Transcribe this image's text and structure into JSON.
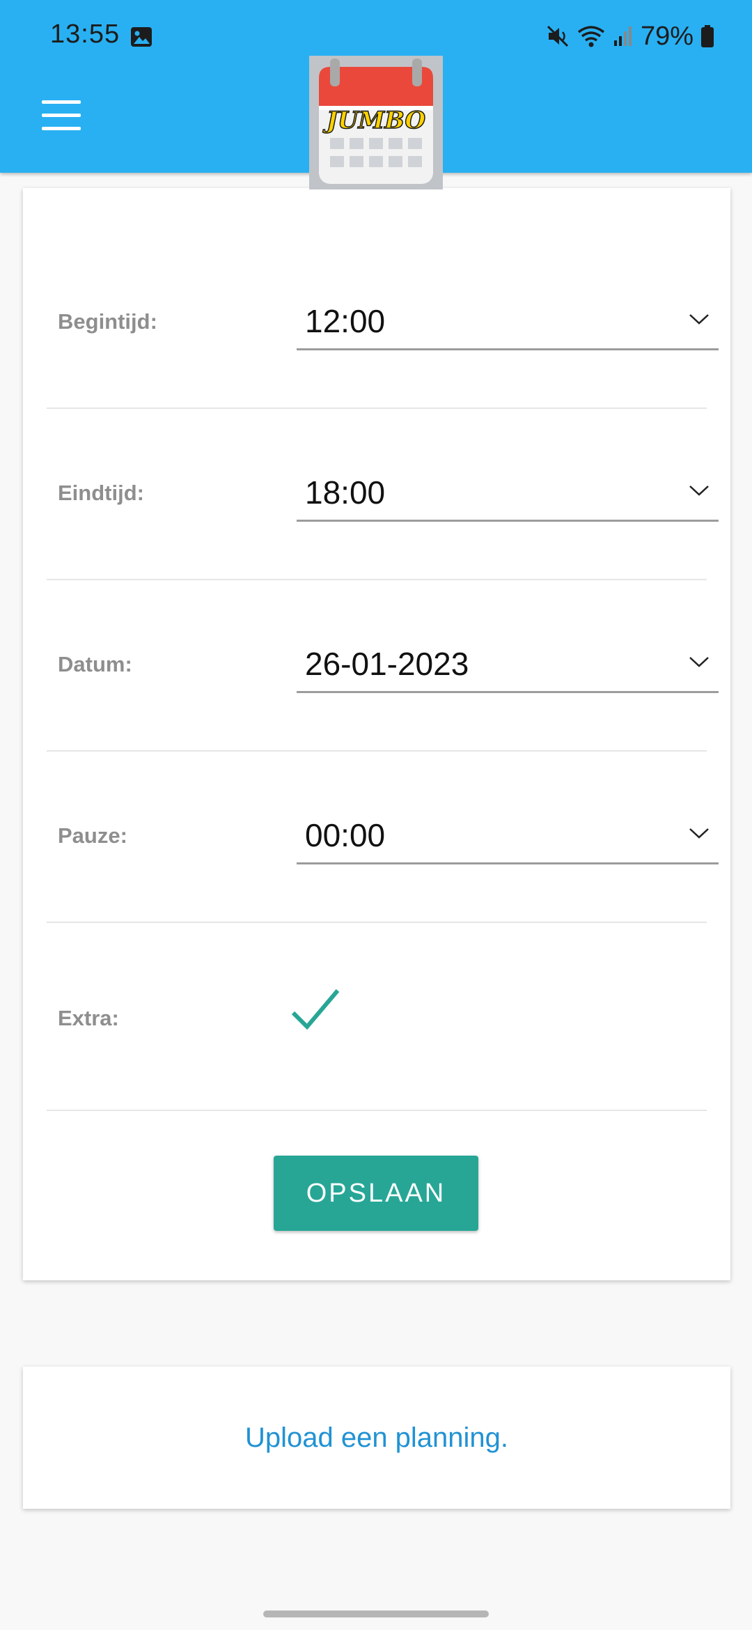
{
  "status_bar": {
    "time": "13:55",
    "battery": "79%",
    "icons": [
      "image-icon",
      "mute-icon",
      "wifi-icon",
      "signal-icon",
      "battery-icon"
    ]
  },
  "app_bar": {
    "color": "#29b0f2",
    "menu_icon": "hamburger-menu-icon",
    "logo_text": "JUMBO"
  },
  "form": {
    "fields": [
      {
        "label": "Begintijd:",
        "value": "12:00"
      },
      {
        "label": "Eindtijd:",
        "value": "18:00"
      },
      {
        "label": "Datum:",
        "value": "26-01-2023"
      },
      {
        "label": "Pauze:",
        "value": "00:00"
      }
    ],
    "extra": {
      "label": "Extra:",
      "checked": true
    },
    "save_label": "OPSLAAN"
  },
  "upload": {
    "link_text": "Upload een planning."
  },
  "colors": {
    "accent": "#27a696",
    "link": "#2192d3",
    "label": "#8e8e8e"
  }
}
